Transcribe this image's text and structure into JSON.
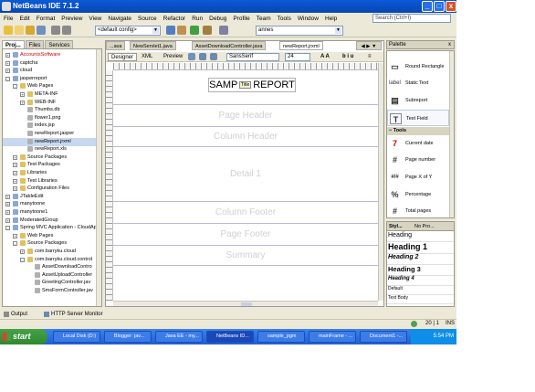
{
  "window": {
    "title": "NetBeans IDE 7.1.2",
    "minimize": "_",
    "maximize": "□",
    "close": "x"
  },
  "menu": [
    "File",
    "Edit",
    "Format",
    "Preview",
    "View",
    "Navigate",
    "Source",
    "Refactor",
    "Run",
    "Debug",
    "Profile",
    "Team",
    "Tools",
    "Window",
    "Help"
  ],
  "search": {
    "placeholder": "Search (Ctrl+I)"
  },
  "toolbar": {
    "config": "<default config>",
    "combo2": "annes"
  },
  "left_tabs": [
    "Proj...",
    "Files",
    "Services"
  ],
  "tree": [
    {
      "label": "AccountsSoftware",
      "level": 0,
      "exp": "+",
      "color": "#c00"
    },
    {
      "label": "captcha",
      "level": 0,
      "exp": "+",
      "color": "#000"
    },
    {
      "label": "cloud",
      "level": 0,
      "exp": "+",
      "color": "#000"
    },
    {
      "label": "jasperreport",
      "level": 0,
      "exp": "-",
      "color": "#000"
    },
    {
      "label": "Web Pages",
      "level": 1,
      "exp": "-",
      "color": "#000"
    },
    {
      "label": "META-INF",
      "level": 2,
      "exp": "+",
      "color": "#000"
    },
    {
      "label": "WEB-INF",
      "level": 2,
      "exp": "+",
      "color": "#000"
    },
    {
      "label": "Thumbs.db",
      "level": 2,
      "exp": "",
      "color": "#000"
    },
    {
      "label": "flower1.png",
      "level": 2,
      "exp": "",
      "color": "#000"
    },
    {
      "label": "index.jsp",
      "level": 2,
      "exp": "",
      "color": "#000"
    },
    {
      "label": "newReport.jasper",
      "level": 2,
      "exp": "",
      "color": "#000"
    },
    {
      "label": "newReport.jrxml",
      "level": 2,
      "exp": "",
      "color": "#000",
      "selected": true
    },
    {
      "label": "newReport.xls",
      "level": 2,
      "exp": "",
      "color": "#000"
    },
    {
      "label": "Source Packages",
      "level": 1,
      "exp": "+",
      "color": "#000"
    },
    {
      "label": "Test Packages",
      "level": 1,
      "exp": "+",
      "color": "#000"
    },
    {
      "label": "Libraries",
      "level": 1,
      "exp": "+",
      "color": "#000"
    },
    {
      "label": "Test Libraries",
      "level": 1,
      "exp": "+",
      "color": "#000"
    },
    {
      "label": "Configuration Files",
      "level": 1,
      "exp": "+",
      "color": "#000"
    },
    {
      "label": "JTableEdit",
      "level": 0,
      "exp": "+",
      "color": "#000"
    },
    {
      "label": "manytoone",
      "level": 0,
      "exp": "+",
      "color": "#000"
    },
    {
      "label": "manytoone1",
      "level": 0,
      "exp": "+",
      "color": "#000"
    },
    {
      "label": "ModeratedGroup",
      "level": 0,
      "exp": "+",
      "color": "#000"
    },
    {
      "label": "Spring MVC Application - CloudApp",
      "level": 0,
      "exp": "-",
      "color": "#000"
    },
    {
      "label": "Web Pages",
      "level": 1,
      "exp": "+",
      "color": "#000"
    },
    {
      "label": "Source Packages",
      "level": 1,
      "exp": "-",
      "color": "#000"
    },
    {
      "label": "com.barryku.cloud",
      "level": 2,
      "exp": "+",
      "color": "#000"
    },
    {
      "label": "com.barryku.cloud.control",
      "level": 2,
      "exp": "-",
      "color": "#000"
    },
    {
      "label": "AssetDownloadContro",
      "level": 3,
      "exp": "",
      "color": "#000"
    },
    {
      "label": "AssetUploadController",
      "level": 3,
      "exp": "",
      "color": "#000"
    },
    {
      "label": "GreetingController.jav",
      "level": 3,
      "exp": "",
      "color": "#000"
    },
    {
      "label": "SmsFormController.jav",
      "level": 3,
      "exp": "",
      "color": "#000"
    }
  ],
  "editor_tabs": [
    "...ava",
    "NewServlet1.java",
    "AssetDownloadController.java",
    "newReport.jrxml"
  ],
  "designer": {
    "tabs": [
      "Designer",
      "XML",
      "Preview"
    ],
    "font": "SansSerif",
    "size": "24"
  },
  "report": {
    "title": "SAMPLE REPORT",
    "title_left": "SAMP",
    "title_tag": "Title",
    "title_right": "REPORT",
    "bands": [
      "Page Header",
      "Column Header",
      "Detail 1",
      "Column Footer",
      "Page Footer",
      "Summary"
    ]
  },
  "palette": {
    "title": "Palette",
    "items": [
      {
        "label": "Round Rectangle",
        "icon": "▭"
      },
      {
        "label": "Static Text",
        "icon": "label"
      },
      {
        "label": "Subreport",
        "icon": "▤"
      },
      {
        "label": "Text Field",
        "icon": "T"
      }
    ],
    "tools_header": "Tools",
    "tools": [
      {
        "label": "Current date",
        "icon": "7"
      },
      {
        "label": "Page number",
        "icon": "#"
      },
      {
        "label": "Page X of Y",
        "icon": "#/#"
      },
      {
        "label": "Percentage",
        "icon": "%"
      },
      {
        "label": "Total pages",
        "icon": "#"
      }
    ]
  },
  "styles": {
    "tabs": [
      "Styl...",
      "No Pro..."
    ],
    "rows": [
      "Heading",
      "Heading 1",
      "Heading 2",
      "Heading 3",
      "Heading 4",
      "Default",
      "Text Body"
    ]
  },
  "output_tabs": [
    "Output",
    "HTTP Server Monitor"
  ],
  "status": {
    "position": "20 | 1",
    "mode": "INS"
  },
  "taskbar": {
    "start": "start",
    "items": [
      "Local Disk (D:)",
      "Blogger: jav...",
      "Java EE - my...",
      "NetBeans ID...",
      "sample_pgm",
      "mainFrame - ...",
      "Document1 -..."
    ],
    "clock": "5:54 PM"
  }
}
